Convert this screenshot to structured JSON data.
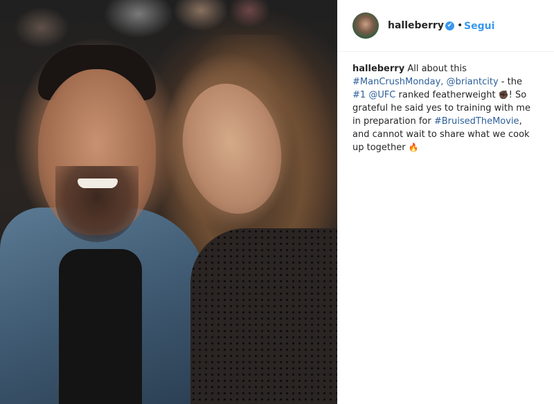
{
  "post": {
    "username": "halleberry",
    "verified_glyph": "✔",
    "separator": "•",
    "follow_label": "Segui",
    "caption": {
      "author": "halleberry",
      "t1": " All about this ",
      "hashtag1": "#ManCrushMonday,",
      "t2": " ",
      "mention1": "@briantcity",
      "t3": " - the ",
      "hashtag2": "#1",
      "t4": " ",
      "mention2": "@UFC",
      "t5": " ranked featherweight ",
      "emoji1": "✊🏿",
      "t6": "! So grateful he said yes to training with me in preparation for ",
      "hashtag3": "#BruisedTheMovie",
      "t7": ", and cannot wait to share what we cook up together ",
      "emoji2": "🔥"
    }
  },
  "icons": {
    "verified": "verified-badge-icon",
    "avatar": "profile-avatar"
  },
  "colors": {
    "link": "#2d5f9a",
    "follow": "#3897f0",
    "verified": "#3897f0",
    "text": "#262626"
  }
}
